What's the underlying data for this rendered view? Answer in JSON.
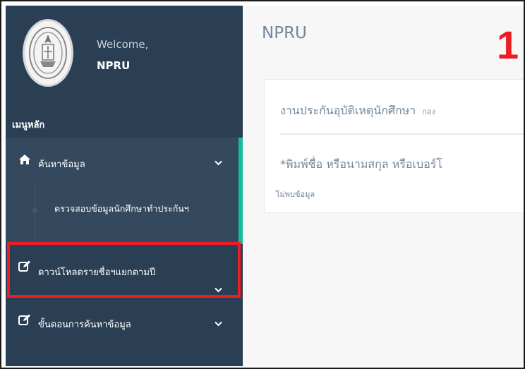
{
  "sidebar": {
    "welcome": "Welcome,",
    "username": "NPRU",
    "menu_heading": "เมนูหลัก",
    "items": [
      {
        "label": "ค้นหาข้อมูล",
        "icon": "home-icon"
      },
      {
        "label": "ดาวน์โหลดรายชื่อฯแยกตามปี",
        "icon": "edit-icon"
      },
      {
        "label": "ขั้นตอนการค้นหาข้อมูล",
        "icon": "edit-icon"
      }
    ],
    "submenu": [
      {
        "label": "ตรวจสอบข้อมูลนักศึกษาทำประกันฯ"
      }
    ]
  },
  "main": {
    "site_title": "NPRU",
    "step_number": "1",
    "panel": {
      "title": "งานประกันอุบัติเหตุนักศึกษา",
      "subtitle": "กอง",
      "hint": "*พิมพ์ชื่อ หรือนามสกุล หรือเบอร์โ",
      "not_found": "ไม่พบข้อมูล"
    }
  },
  "colors": {
    "sidebar_bg": "#2a3f54",
    "active_bg": "#34495e",
    "active_indicator": "#1abb9c",
    "highlight": "#ee1c24",
    "main_bg": "#f7f7f7",
    "text_muted": "#73879c"
  }
}
